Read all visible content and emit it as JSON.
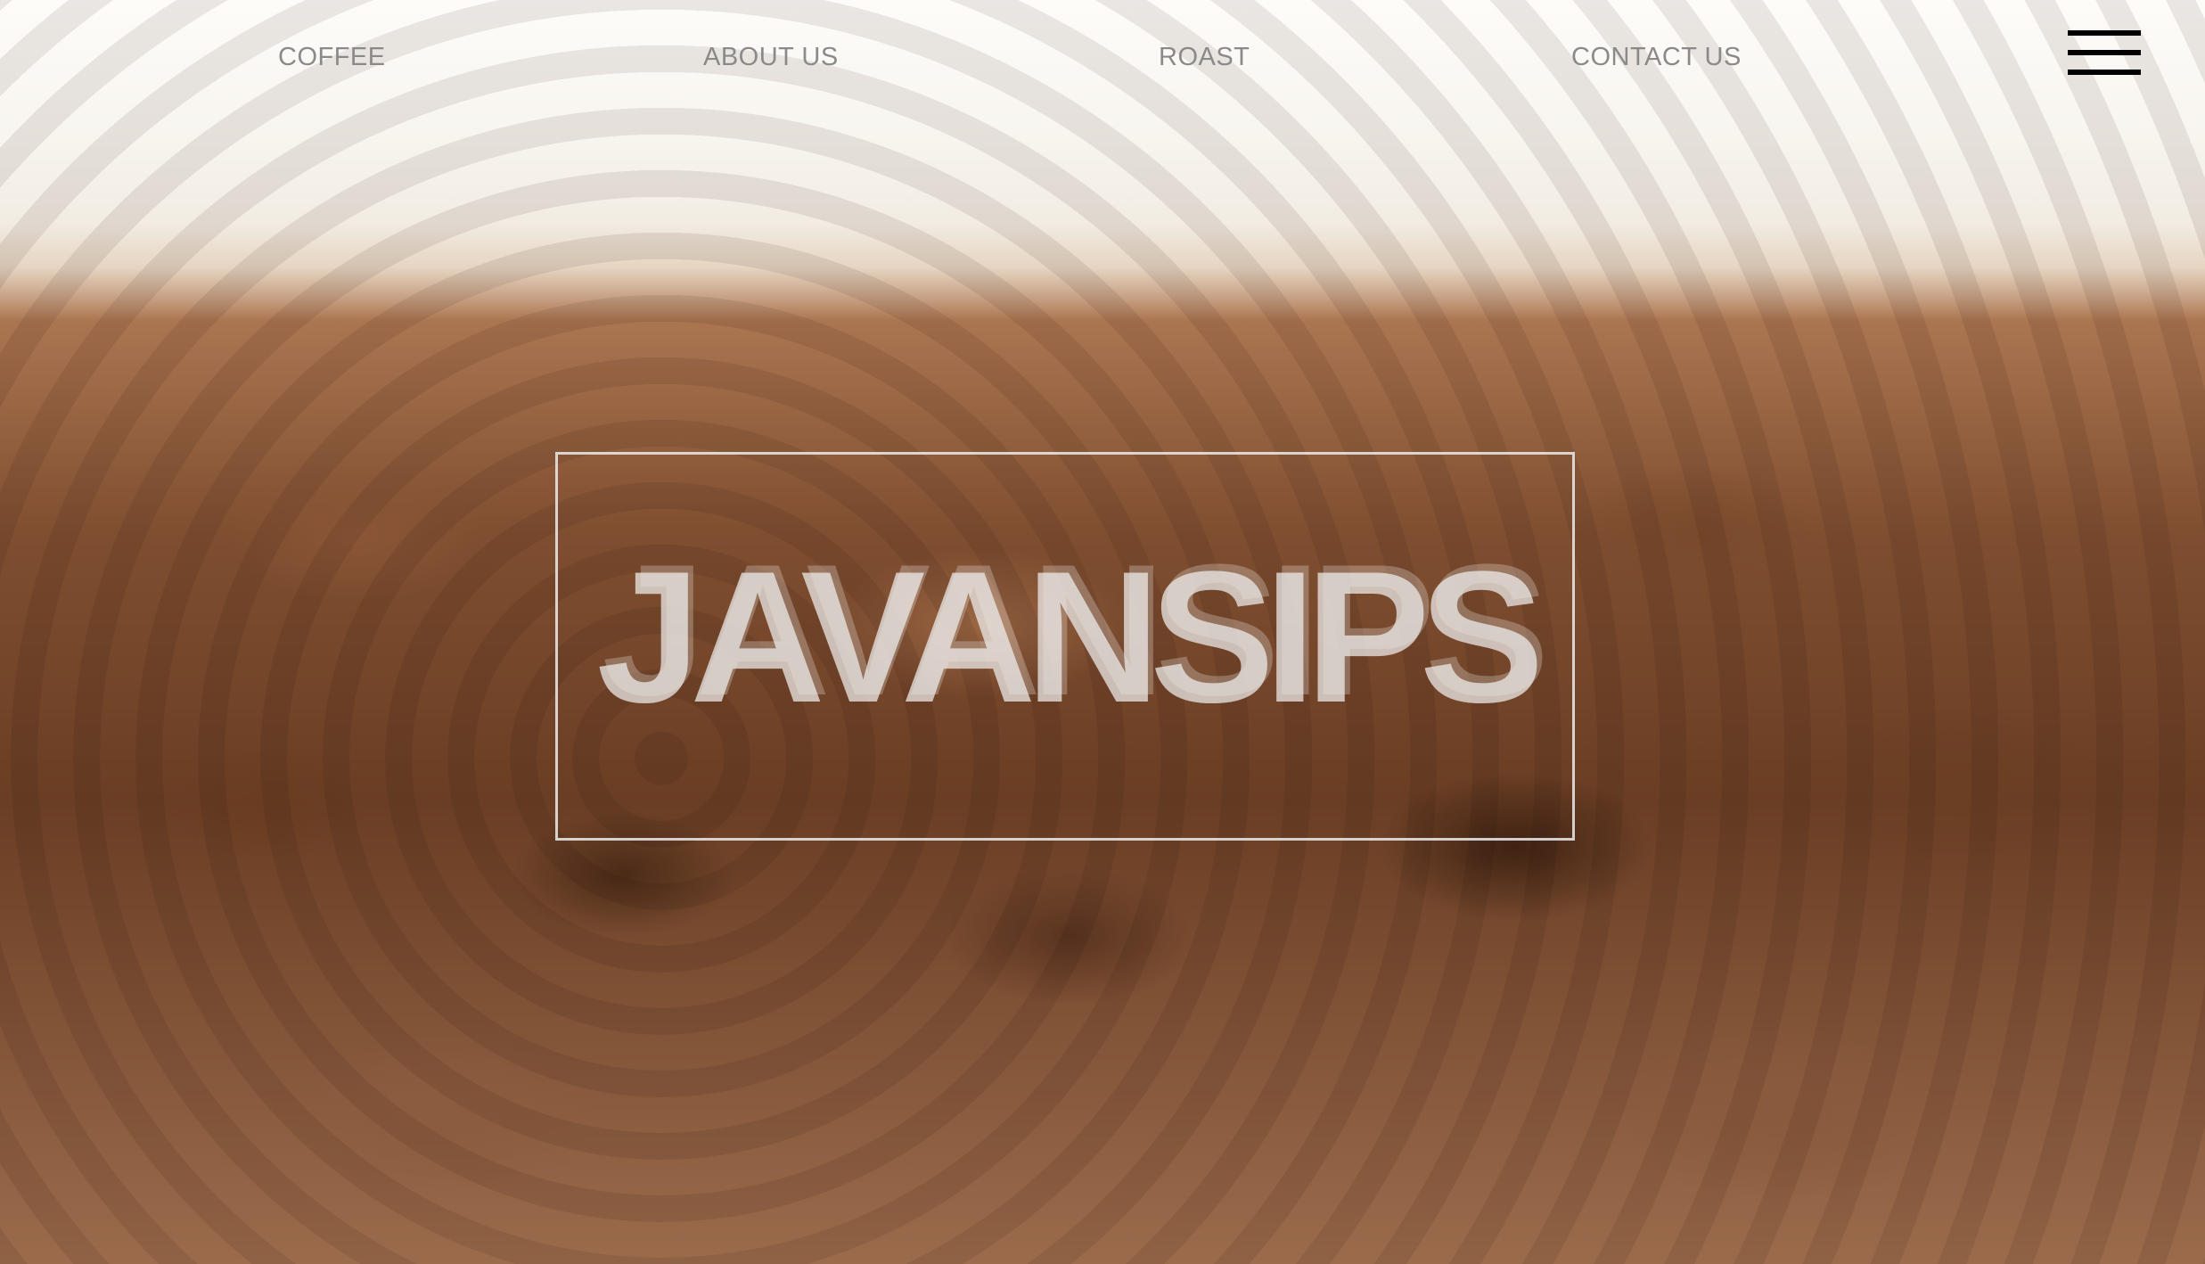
{
  "nav": {
    "items": [
      {
        "label": "COFFEE"
      },
      {
        "label": "ABOUT US"
      },
      {
        "label": "ROAST"
      },
      {
        "label": "CONTACT US"
      }
    ],
    "menu_icon": "hamburger-menu-icon"
  },
  "hero": {
    "logo_text": "JAVANSIPS"
  },
  "colors": {
    "nav_text": "#8a8a8a",
    "menu_icon": "#000000",
    "logo_text": "#f0f0f0"
  }
}
